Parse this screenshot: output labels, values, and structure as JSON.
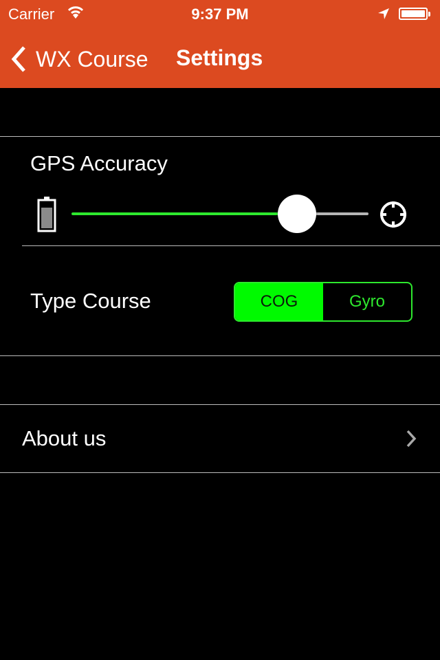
{
  "status_bar": {
    "carrier": "Carrier",
    "time": "9:37 PM",
    "icons": [
      "wifi-icon",
      "location-arrow-icon",
      "battery-icon"
    ]
  },
  "nav_bar": {
    "back_label": "WX Course",
    "title": "Settings",
    "color": "#dc4a20"
  },
  "gps_accuracy": {
    "label": "GPS Accuracy",
    "min_icon": "battery-low-icon",
    "max_icon": "crosshair-icon",
    "value": 0.76,
    "accent": "#2ee82e"
  },
  "type_course": {
    "label": "Type Course",
    "options": [
      "COG",
      "Gyro"
    ],
    "selected": "COG",
    "accent": "#00fa00"
  },
  "about": {
    "label": "About us",
    "icon": "chevron-right-icon"
  }
}
